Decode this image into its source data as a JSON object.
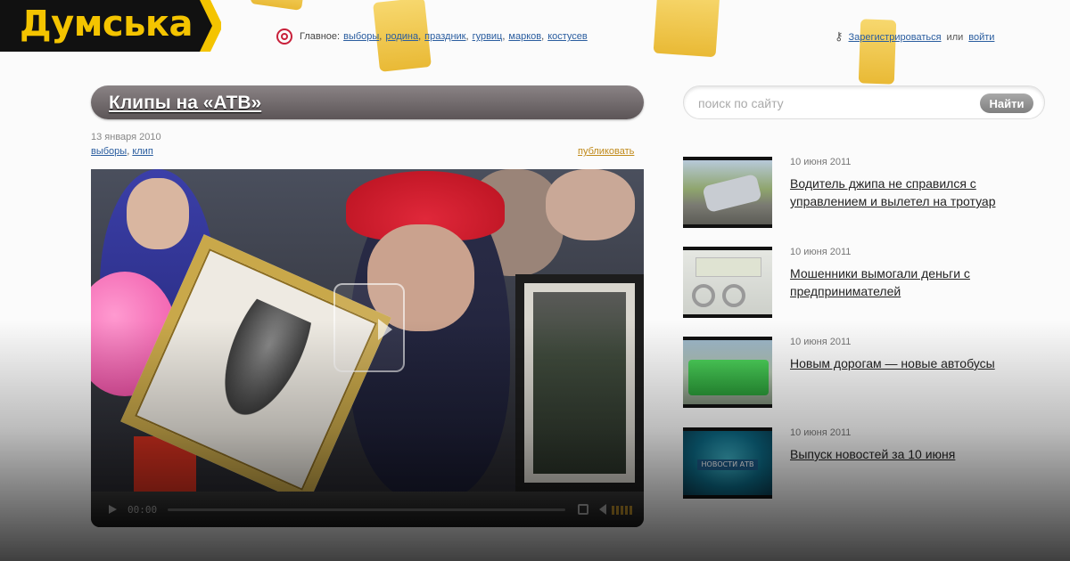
{
  "brand": {
    "name": "Думська"
  },
  "topnav": {
    "label": "Главное:",
    "links": [
      "выборы",
      "родина",
      "праздник",
      "гурвиц",
      "марков",
      "костусев"
    ]
  },
  "auth": {
    "register": "Зарегистрироваться",
    "or": "или",
    "login": "войти"
  },
  "article": {
    "title": "Клипы на «АТВ»",
    "date": "13 января 2010",
    "tags": [
      "выборы",
      "клип"
    ],
    "publish": "публиковать"
  },
  "player": {
    "time": "00:00"
  },
  "search": {
    "placeholder": "поиск по сайту",
    "button": "Найти"
  },
  "news": [
    {
      "date": "10 июня 2011",
      "title": "Водитель джипа не справился с управлением и вылетел на тротуар"
    },
    {
      "date": "10 июня 2011",
      "title": "Мошенники вымогали деньги с предпринимателей"
    },
    {
      "date": "10 июня 2011",
      "title": "Новым дорогам — новые автобусы"
    },
    {
      "date": "10 июня 2011",
      "title": "Выпуск новостей за 10 июня"
    }
  ],
  "thumb_logo": "НОВОСТИ АТВ"
}
